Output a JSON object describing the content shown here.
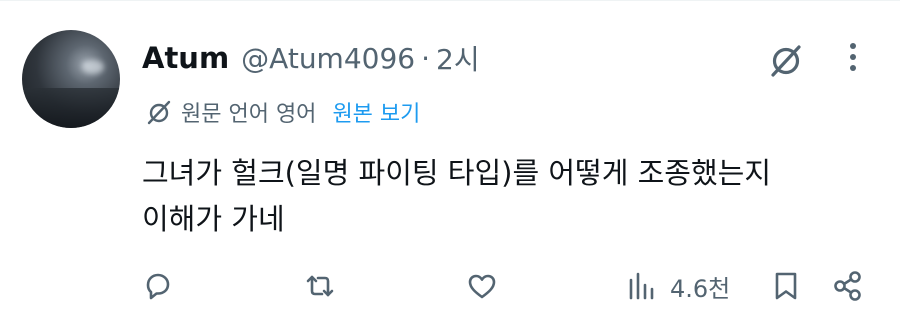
{
  "post": {
    "author_name": "Atum",
    "author_handle": "@Atum4096",
    "separator": "·",
    "timestamp": "2시",
    "translation_note": "원문 언어 영어",
    "show_original_label": "원본 보기",
    "text_line1": "그녀가 헐크(일명 파이팅 타입)를 어떻게 조종했는지",
    "text_line2": "이해가 가네"
  },
  "stats": {
    "views": "4.6천"
  },
  "icons": {
    "header": [
      "grok-icon",
      "more-icon"
    ],
    "translate": "translate-icon",
    "actions": [
      "reply-icon",
      "retweet-icon",
      "like-icon",
      "views-icon",
      "bookmark-icon",
      "share-icon"
    ]
  },
  "colors": {
    "text_primary": "#0f1419",
    "text_secondary": "#536471",
    "link_blue": "#1d9bf0"
  }
}
